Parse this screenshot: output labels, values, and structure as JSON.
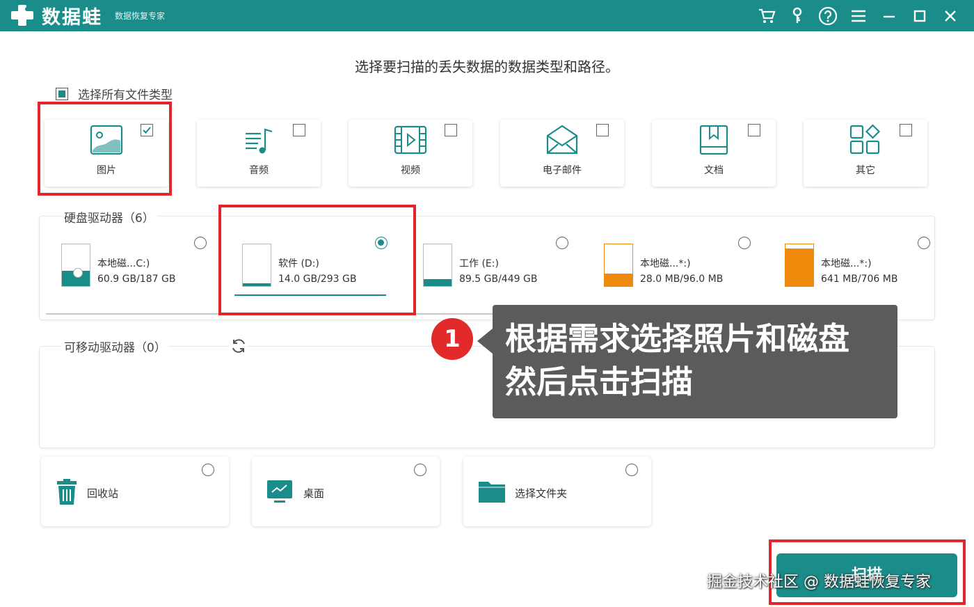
{
  "app": {
    "logo_text": "数据蛙",
    "subtitle": "数据恢复专家",
    "accent": "#1a8c8a",
    "window_controls": [
      "cart-icon",
      "key-icon",
      "help-icon",
      "menu-icon",
      "minimize-icon",
      "maximize-icon",
      "close-icon"
    ]
  },
  "heading": "选择要扫描的丢失数据的数据类型和路径。",
  "select_all": {
    "label": "选择所有文件类型",
    "checked": "partial"
  },
  "file_types": [
    {
      "label": "图片",
      "icon": "image-icon",
      "checked": true
    },
    {
      "label": "音频",
      "icon": "music-icon",
      "checked": false
    },
    {
      "label": "视频",
      "icon": "video-icon",
      "checked": false
    },
    {
      "label": "电子邮件",
      "icon": "email-icon",
      "checked": false
    },
    {
      "label": "文档",
      "icon": "document-icon",
      "checked": false
    },
    {
      "label": "其它",
      "icon": "other-icon",
      "checked": false
    }
  ],
  "hard_drives": {
    "title": "硬盘驱动器（6）",
    "items": [
      {
        "name": "本地磁...C:)",
        "size": "60.9 GB/187 GB",
        "selected": false,
        "fill_color": "#1a8c8a",
        "used_fraction": 0.35
      },
      {
        "name": "软件 (D:)",
        "size": "14.0 GB/293 GB",
        "selected": true,
        "fill_color": "#1a8c8a",
        "used_fraction": 0.05
      },
      {
        "name": "工作 (E:)",
        "size": "89.5 GB/449 GB",
        "selected": false,
        "fill_color": "#1a8c8a",
        "used_fraction": 0.2
      },
      {
        "name": "本地磁...*:)",
        "size": "28.0 MB/96.0 MB",
        "selected": false,
        "fill_color": "#ef8a0c",
        "used_fraction": 0.29
      },
      {
        "name": "本地磁...*:)",
        "size": "641 MB/706 MB",
        "selected": false,
        "fill_color": "#ef8a0c",
        "used_fraction": 0.91
      }
    ]
  },
  "removable": {
    "title": "可移动驱动器（0）"
  },
  "locations": [
    {
      "label": "回收站",
      "icon": "recycle-bin-icon",
      "selected": false
    },
    {
      "label": "桌面",
      "icon": "desktop-icon",
      "selected": false
    },
    {
      "label": "选择文件夹",
      "icon": "folder-icon",
      "selected": false
    }
  ],
  "callout": {
    "number": "1",
    "line1": "根据需求选择照片和磁盘",
    "line2": "然后点击扫描"
  },
  "scan_button": "扫描",
  "watermark": "掘金技术社区 @ 数据蛙恢复专家"
}
